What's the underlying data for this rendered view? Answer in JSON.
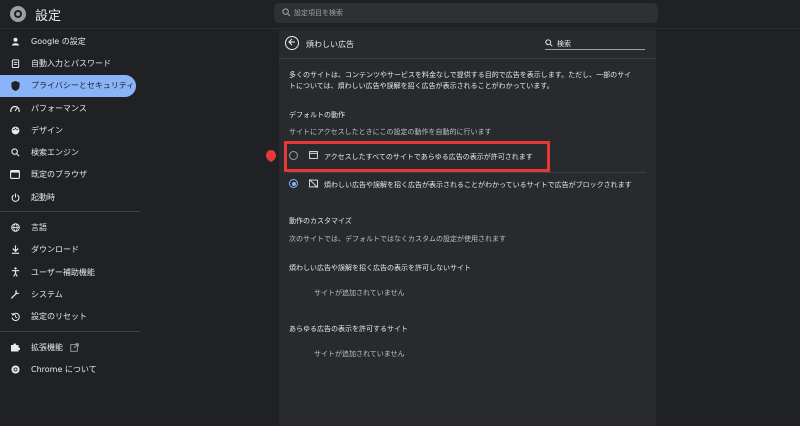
{
  "header": {
    "app_title": "設定",
    "search_placeholder": "設定項目を検索"
  },
  "sidebar": {
    "items": [
      {
        "label": "Google の設定",
        "icon": "person-icon"
      },
      {
        "label": "自動入力とパスワード",
        "icon": "clipboard-icon"
      },
      {
        "label": "プライバシーとセキュリティ",
        "icon": "shield-icon",
        "active": true
      },
      {
        "label": "パフォーマンス",
        "icon": "speedometer-icon"
      },
      {
        "label": "デザイン",
        "icon": "palette-icon"
      },
      {
        "label": "検索エンジン",
        "icon": "search-icon"
      },
      {
        "label": "既定のブラウザ",
        "icon": "browser-icon"
      },
      {
        "label": "起動時",
        "icon": "power-icon"
      },
      {
        "label": "言語",
        "icon": "globe-icon"
      },
      {
        "label": "ダウンロード",
        "icon": "download-icon"
      },
      {
        "label": "ユーザー補助機能",
        "icon": "accessibility-icon"
      },
      {
        "label": "システム",
        "icon": "wrench-icon"
      },
      {
        "label": "設定のリセット",
        "icon": "reset-icon"
      },
      {
        "label": "拡張機能",
        "icon": "puzzle-icon"
      },
      {
        "label": "Chrome について",
        "icon": "chrome-icon"
      }
    ]
  },
  "panel": {
    "title": "煩わしい広告",
    "search_value": "検索",
    "description_line1": "多くのサイトは、コンテンツやサービスを料金なしで提供する目的で広告を表示します。ただし、一部のサイ",
    "description_line2": "トについては、煩わしい広告や誤解を招く広告が表示されることがわかっています。",
    "default_heading": "デフォルトの動作",
    "default_sub": "サイトにアクセスしたときにこの設定の動作を自動的に行います",
    "option_allow": "アクセスしたすべてのサイトであらゆる広告の表示が許可されます",
    "option_block": "煩わしい広告や誤解を招く広告が表示されることがわかっているサイトで広告がブロックされます",
    "custom_heading": "動作のカスタマイズ",
    "custom_sub": "次のサイトでは、デフォルトではなくカスタムの設定が使用されます",
    "block_list_heading": "煩わしい広告や誤解を招く広告の表示を許可しないサイト",
    "block_list_empty": "サイトが追加されていません",
    "allow_list_heading": "あらゆる広告の表示を許可するサイト",
    "allow_list_empty": "サイトが追加されていません"
  },
  "colors": {
    "background": "#202124",
    "panel": "#292a2d",
    "accent": "#8ab4f8",
    "highlight": "#e53935"
  }
}
